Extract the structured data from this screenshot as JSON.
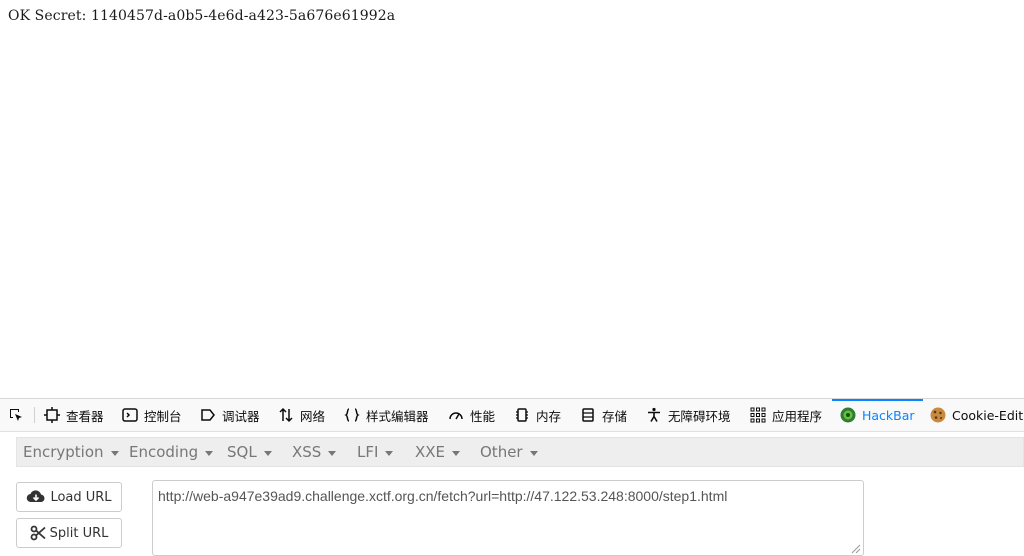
{
  "page": {
    "secret_text": "OK Secret: 1140457d-a0b5-4e6d-a423-5a676e61992a"
  },
  "devtools": {
    "tabs": [
      {
        "label": "查看器",
        "icon": "inspector-icon"
      },
      {
        "label": "控制台",
        "icon": "console-icon"
      },
      {
        "label": "调试器",
        "icon": "debugger-icon"
      },
      {
        "label": "网络",
        "icon": "network-icon"
      },
      {
        "label": "样式编辑器",
        "icon": "style-editor-icon"
      },
      {
        "label": "性能",
        "icon": "performance-icon"
      },
      {
        "label": "内存",
        "icon": "memory-icon"
      },
      {
        "label": "存储",
        "icon": "storage-icon"
      },
      {
        "label": "无障碍环境",
        "icon": "accessibility-icon"
      },
      {
        "label": "应用程序",
        "icon": "application-icon"
      },
      {
        "label": "HackBar",
        "icon": "hackbar-icon"
      },
      {
        "label": "Cookie-Edit",
        "icon": "cookie-icon"
      }
    ],
    "active_tab": "HackBar",
    "accent_color": "#0a84ff"
  },
  "hackbar": {
    "menu": [
      "Encryption",
      "Encoding",
      "SQL",
      "XSS",
      "LFI",
      "XXE",
      "Other"
    ],
    "load_url_label": "Load URL",
    "split_url_label": "Split URL",
    "url_value": "http://web-a947e39ad9.challenge.xctf.org.cn/fetch?url=http://47.122.53.248:8000/step1.html"
  }
}
